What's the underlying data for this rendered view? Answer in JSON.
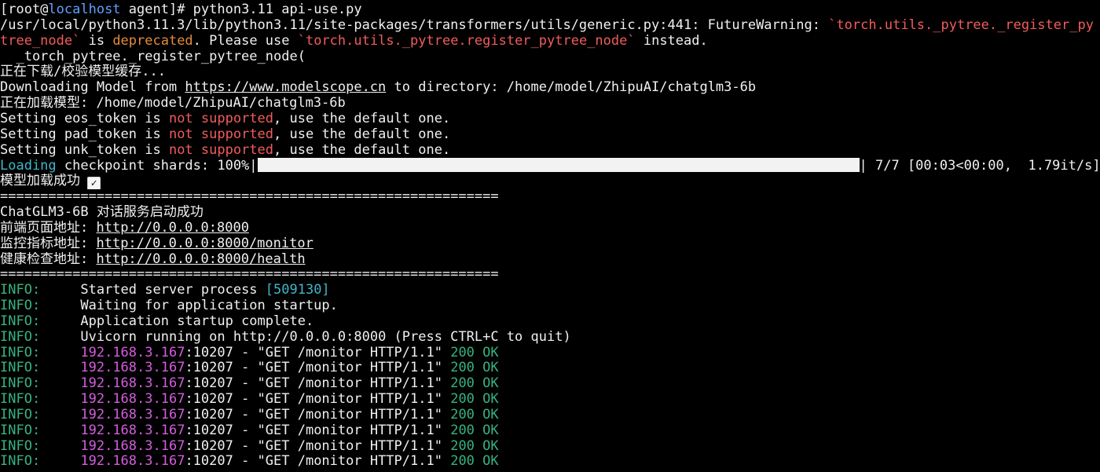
{
  "prompt": {
    "open": "[root@",
    "host": "localhost",
    "path_end": " agent]# ",
    "command": "python3.11 api-use.py"
  },
  "warning": {
    "prefix": "/usr/local/python3.11.3/lib/python3.11/site-packages/transformers/utils/generic.py:441: FutureWarning: ",
    "code1": "`torch.utils._pytree._register_pytree_node`",
    "is_text": " is ",
    "deprecated": "deprecated",
    "please_use": ". Please use ",
    "code2": "`torch.utils._pytree.register_pytree_node`",
    "instead": " instead.",
    "trace": "  _torch_pytree._register_pytree_node("
  },
  "download_cache": "正在下载/校验模型缓存...",
  "download": {
    "prefix": "Downloading Model from ",
    "url": "https://www.modelscope.cn",
    "suffix": " to directory: /home/model/ZhipuAI/chatglm3-6b"
  },
  "loading_model": "正在加载模型: /home/model/ZhipuAI/chatglm3-6b",
  "token_lines": [
    {
      "prefix": "Setting eos_token ",
      "is": "is ",
      "not": "not ",
      "supported": "supported",
      "suffix": ", use the default one."
    },
    {
      "prefix": "Setting pad_token ",
      "is": "is ",
      "not": "not ",
      "supported": "supported",
      "suffix": ", use the default one."
    },
    {
      "prefix": "Setting unk_token ",
      "is": "is ",
      "not": "not ",
      "supported": "supported",
      "suffix": ", use the default one."
    }
  ],
  "checkpoint": {
    "loading": "Loading",
    "label": " checkpoint shards: 100%|",
    "progress_fraction": 1.0,
    "stats": "| 7/7 [00:03<00:00,  1.79it/s]"
  },
  "model_loaded": "模型加载成功",
  "checkmark": "✓",
  "separator": "==============================================================",
  "service_title": "ChatGLM3-6B 对话服务启动成功",
  "endpoints": [
    {
      "label": "前端页面地址: ",
      "url": "http://0.0.0.0:8000"
    },
    {
      "label": "监控指标地址: ",
      "url": "http://0.0.0.0:8000/monitor"
    },
    {
      "label": "健康检查地址: ",
      "url": "http://0.0.0.0:8000/health"
    }
  ],
  "info_tag": "INFO:",
  "server": {
    "started": "Started server process ",
    "pid": "[509130]",
    "waiting": "Waiting for application startup.",
    "complete": "Application startup complete.",
    "uvicorn": "Uvicorn running on http://0.0.0.0:8000 (Press CTRL+C to quit)"
  },
  "access_logs": [
    {
      "ip": "192.168.3.167",
      "rest": ":10207 - \"GET /monitor HTTP/1.1\" ",
      "status": "200 OK"
    },
    {
      "ip": "192.168.3.167",
      "rest": ":10207 - \"GET /monitor HTTP/1.1\" ",
      "status": "200 OK"
    },
    {
      "ip": "192.168.3.167",
      "rest": ":10207 - \"GET /monitor HTTP/1.1\" ",
      "status": "200 OK"
    },
    {
      "ip": "192.168.3.167",
      "rest": ":10207 - \"GET /monitor HTTP/1.1\" ",
      "status": "200 OK"
    },
    {
      "ip": "192.168.3.167",
      "rest": ":10207 - \"GET /monitor HTTP/1.1\" ",
      "status": "200 OK"
    },
    {
      "ip": "192.168.3.167",
      "rest": ":10207 - \"GET /monitor HTTP/1.1\" ",
      "status": "200 OK"
    },
    {
      "ip": "192.168.3.167",
      "rest": ":10207 - \"GET /monitor HTTP/1.1\" ",
      "status": "200 OK"
    },
    {
      "ip": "192.168.3.167",
      "rest": ":10207 - \"GET /monitor HTTP/1.1\" ",
      "status": "200 OK"
    }
  ],
  "colors": {
    "background": "#000000",
    "foreground": "#f0f0f0",
    "red": "#f25c5c",
    "orange": "#e58a3a",
    "green": "#37b37f",
    "cyan": "#3fb7ca",
    "magenta": "#d65ce0",
    "host_blue": "#5ea1ff"
  }
}
